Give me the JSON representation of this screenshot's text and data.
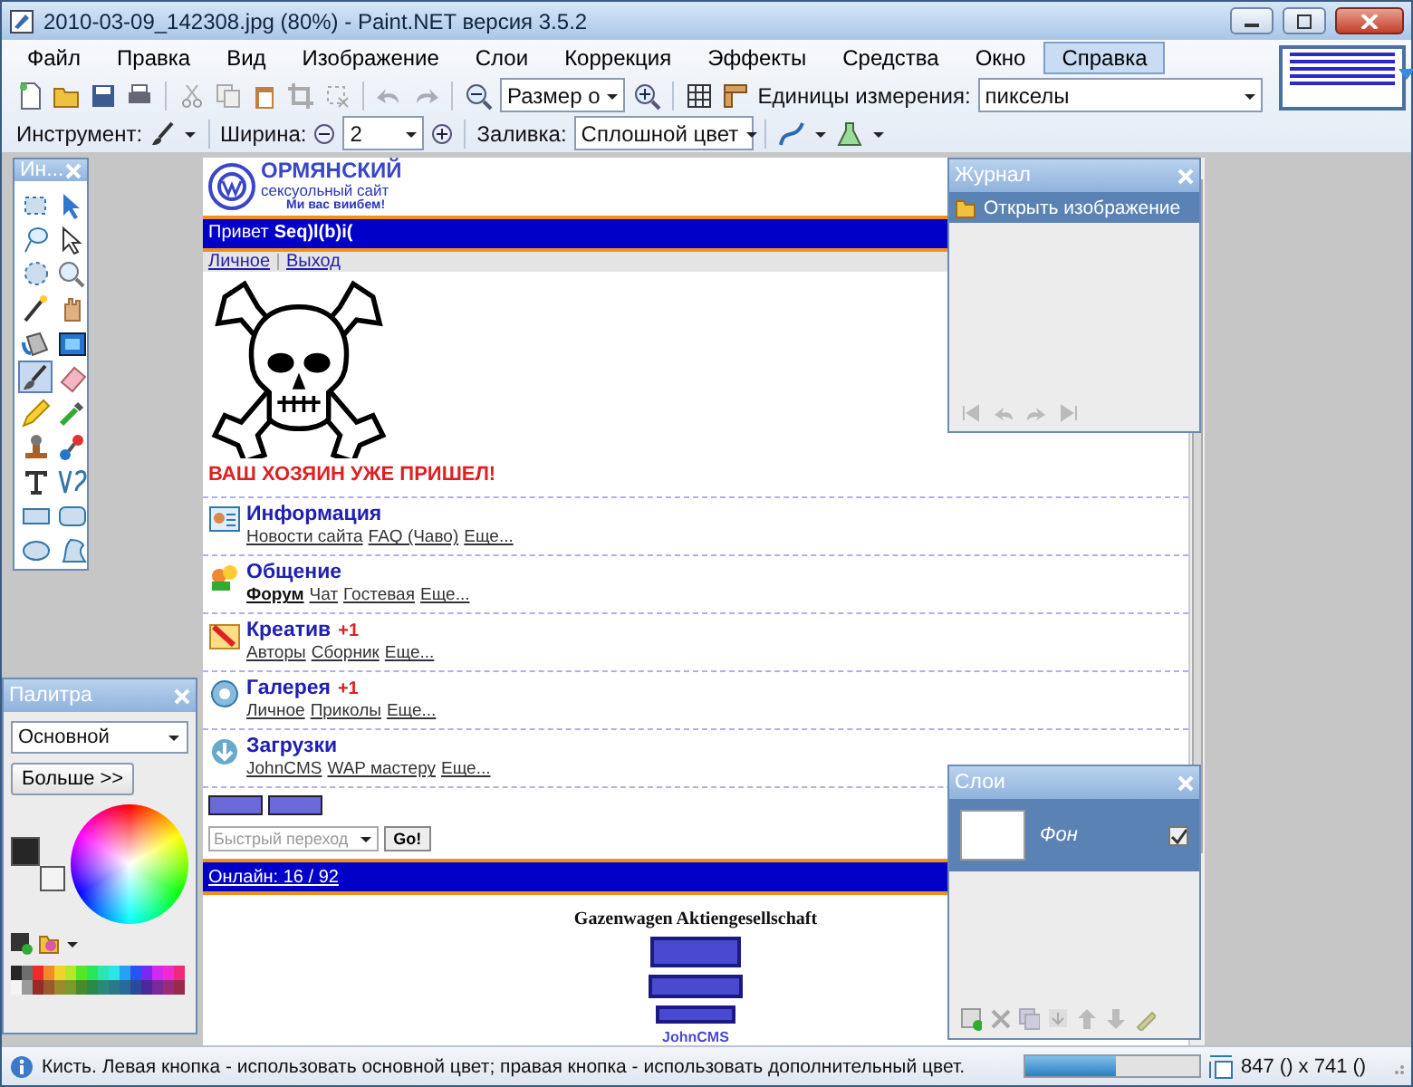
{
  "window": {
    "title": "2010-03-09_142308.jpg (80%) - Paint.NET версия 3.5.2"
  },
  "menu": [
    {
      "label": "Файл",
      "selected": false
    },
    {
      "label": "Правка",
      "selected": false
    },
    {
      "label": "Вид",
      "selected": false
    },
    {
      "label": "Изображение",
      "selected": false
    },
    {
      "label": "Слои",
      "selected": false
    },
    {
      "label": "Коррекция",
      "selected": false
    },
    {
      "label": "Эффекты",
      "selected": false
    },
    {
      "label": "Средства",
      "selected": false
    },
    {
      "label": "Окно",
      "selected": false
    },
    {
      "label": "Справка",
      "selected": true
    }
  ],
  "toolbar": {
    "zoom_value": "Размер о",
    "units_label": "Единицы измерения:",
    "units_value": "пикселы"
  },
  "tool_options": {
    "tool_label": "Инструмент:",
    "width_label": "Ширина:",
    "width_value": "2",
    "fill_label": "Заливка:",
    "fill_value": "Сплошной цвет"
  },
  "tools_panel": {
    "title": "Ин...",
    "tools": [
      {
        "kind": "rect-select",
        "selected": false
      },
      {
        "kind": "move",
        "selected": false
      },
      {
        "kind": "lasso",
        "selected": false
      },
      {
        "kind": "move-outline",
        "selected": false
      },
      {
        "kind": "ellipse-select",
        "selected": false
      },
      {
        "kind": "zoom",
        "selected": false
      },
      {
        "kind": "wand",
        "selected": false
      },
      {
        "kind": "hand",
        "selected": false
      },
      {
        "kind": "bucket",
        "selected": false
      },
      {
        "kind": "gradient",
        "selected": false
      },
      {
        "kind": "brush",
        "selected": true
      },
      {
        "kind": "eraser",
        "selected": false
      },
      {
        "kind": "pencil",
        "selected": false
      },
      {
        "kind": "pipette",
        "selected": false
      },
      {
        "kind": "stamp",
        "selected": false
      },
      {
        "kind": "recolor",
        "selected": false
      },
      {
        "kind": "text",
        "selected": false
      },
      {
        "kind": "curve",
        "selected": false
      },
      {
        "kind": "rectangle",
        "selected": false
      },
      {
        "kind": "rounded-rectangle",
        "selected": false
      },
      {
        "kind": "ellipse",
        "selected": false
      },
      {
        "kind": "freeform",
        "selected": false
      }
    ]
  },
  "canvas_page": {
    "logo": {
      "title": "ОРМЯНСКИЙ",
      "subtitle": "сексуольный сайт",
      "tagline": "Ми вас виибем!"
    },
    "greeting": "Привет",
    "user": "Seq)l(b)i(",
    "nav": [
      "Личное",
      "Выход"
    ],
    "alert": "ВАШ ХОЗЯИН УЖЕ ПРИШЕЛ!",
    "sections": [
      {
        "kind": "info",
        "title": "Информация",
        "links": [
          {
            "label": "Новости сайта",
            "active": false
          },
          {
            "label": "FAQ (Чаво)",
            "active": false
          },
          {
            "label": "Еще...",
            "active": false
          }
        ]
      },
      {
        "kind": "chat",
        "title": "Общение",
        "links": [
          {
            "label": "Форум",
            "active": true
          },
          {
            "label": "Чат",
            "active": false
          },
          {
            "label": "Гостевая",
            "active": false
          },
          {
            "label": "Еще...",
            "active": false
          }
        ]
      },
      {
        "kind": "creative",
        "title": "Креатив",
        "badge": "+1",
        "links": [
          {
            "label": "Авторы",
            "active": false
          },
          {
            "label": "Сборник",
            "active": false
          },
          {
            "label": "Еще...",
            "active": false
          }
        ]
      },
      {
        "kind": "gallery",
        "title": "Галерея",
        "badge": "+1",
        "links": [
          {
            "label": "Личное",
            "active": false
          },
          {
            "label": "Приколы",
            "active": false
          },
          {
            "label": "Еще...",
            "active": false
          }
        ]
      },
      {
        "kind": "downloads",
        "title": "Загрузки",
        "links": [
          {
            "label": "JohnCMS",
            "active": false
          },
          {
            "label": "WAP мастеру",
            "active": false
          },
          {
            "label": "Еще...",
            "active": false
          }
        ]
      }
    ],
    "jump_placeholder": "Быстрый переход",
    "go_button": "Go!",
    "online": "Онлайн: 16 / 92",
    "company": "Gazenwagen Aktiengesellschaft",
    "footer": "JohnCMS"
  },
  "history_panel": {
    "title": "Журнал",
    "items": [
      {
        "label": "Открыть изображение",
        "selected": true
      }
    ]
  },
  "palette_panel": {
    "title": "Палитра",
    "mode": "Основной",
    "more_button": "Больше >>",
    "current_colors": [
      {
        "color": "#262626"
      },
      {
        "color": "#f4f4f4"
      }
    ],
    "swatches": [
      {
        "color": "#262626"
      },
      {
        "color": "#6e6e6e"
      },
      {
        "color": "#ee2a2a"
      },
      {
        "color": "#f08a2a"
      },
      {
        "color": "#f0d22a"
      },
      {
        "color": "#b4e62a"
      },
      {
        "color": "#54e62a"
      },
      {
        "color": "#2ae65a"
      },
      {
        "color": "#2ae6b4"
      },
      {
        "color": "#2ae6e6"
      },
      {
        "color": "#2aa0f0"
      },
      {
        "color": "#2a54f0"
      },
      {
        "color": "#7a2af0"
      },
      {
        "color": "#d22af0"
      },
      {
        "color": "#f02ad2"
      },
      {
        "color": "#f02a7a"
      },
      {
        "color": "#f4f4f4"
      },
      {
        "color": "#9a9a9a"
      },
      {
        "color": "#9a2a2a"
      },
      {
        "color": "#9a5a2a"
      },
      {
        "color": "#9a8a2a"
      },
      {
        "color": "#7a9a2a"
      },
      {
        "color": "#4a8a2a"
      },
      {
        "color": "#2a8a4a"
      },
      {
        "color": "#2a8a7a"
      },
      {
        "color": "#2a7a8a"
      },
      {
        "color": "#2a6a9a"
      },
      {
        "color": "#2a4a9a"
      },
      {
        "color": "#4a2a9a"
      },
      {
        "color": "#7a2a9a"
      },
      {
        "color": "#9a2a7a"
      },
      {
        "color": "#9a2a4a"
      }
    ]
  },
  "layers_panel": {
    "title": "Слои",
    "layers": [
      {
        "name": "Фон",
        "visible": true,
        "selected": true
      }
    ]
  },
  "status_bar": {
    "text": "Кисть. Левая кнопка - использовать основной цвет; правая кнопка - использовать дополнительный цвет.",
    "level": 0.52,
    "size": "847 () x 741 ()"
  }
}
